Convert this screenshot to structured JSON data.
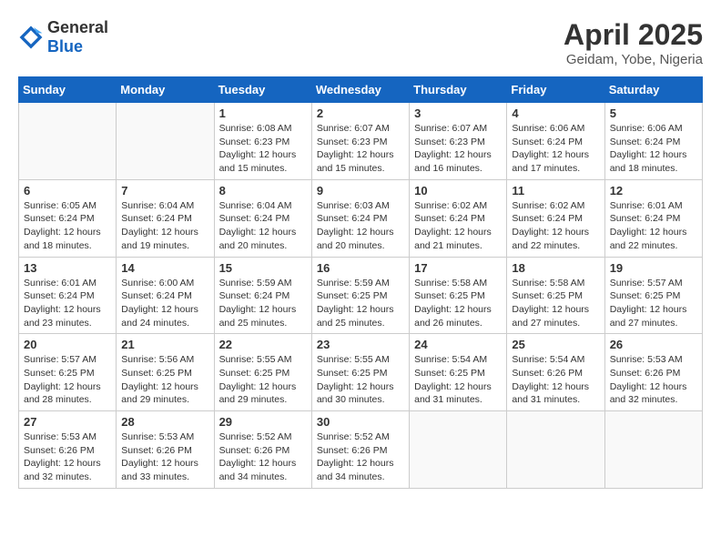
{
  "header": {
    "logo_general": "General",
    "logo_blue": "Blue",
    "month_title": "April 2025",
    "location": "Geidam, Yobe, Nigeria"
  },
  "days_of_week": [
    "Sunday",
    "Monday",
    "Tuesday",
    "Wednesday",
    "Thursday",
    "Friday",
    "Saturday"
  ],
  "weeks": [
    [
      {
        "day": "",
        "info": ""
      },
      {
        "day": "",
        "info": ""
      },
      {
        "day": "1",
        "info": "Sunrise: 6:08 AM\nSunset: 6:23 PM\nDaylight: 12 hours and 15 minutes."
      },
      {
        "day": "2",
        "info": "Sunrise: 6:07 AM\nSunset: 6:23 PM\nDaylight: 12 hours and 15 minutes."
      },
      {
        "day": "3",
        "info": "Sunrise: 6:07 AM\nSunset: 6:23 PM\nDaylight: 12 hours and 16 minutes."
      },
      {
        "day": "4",
        "info": "Sunrise: 6:06 AM\nSunset: 6:24 PM\nDaylight: 12 hours and 17 minutes."
      },
      {
        "day": "5",
        "info": "Sunrise: 6:06 AM\nSunset: 6:24 PM\nDaylight: 12 hours and 18 minutes."
      }
    ],
    [
      {
        "day": "6",
        "info": "Sunrise: 6:05 AM\nSunset: 6:24 PM\nDaylight: 12 hours and 18 minutes."
      },
      {
        "day": "7",
        "info": "Sunrise: 6:04 AM\nSunset: 6:24 PM\nDaylight: 12 hours and 19 minutes."
      },
      {
        "day": "8",
        "info": "Sunrise: 6:04 AM\nSunset: 6:24 PM\nDaylight: 12 hours and 20 minutes."
      },
      {
        "day": "9",
        "info": "Sunrise: 6:03 AM\nSunset: 6:24 PM\nDaylight: 12 hours and 20 minutes."
      },
      {
        "day": "10",
        "info": "Sunrise: 6:02 AM\nSunset: 6:24 PM\nDaylight: 12 hours and 21 minutes."
      },
      {
        "day": "11",
        "info": "Sunrise: 6:02 AM\nSunset: 6:24 PM\nDaylight: 12 hours and 22 minutes."
      },
      {
        "day": "12",
        "info": "Sunrise: 6:01 AM\nSunset: 6:24 PM\nDaylight: 12 hours and 22 minutes."
      }
    ],
    [
      {
        "day": "13",
        "info": "Sunrise: 6:01 AM\nSunset: 6:24 PM\nDaylight: 12 hours and 23 minutes."
      },
      {
        "day": "14",
        "info": "Sunrise: 6:00 AM\nSunset: 6:24 PM\nDaylight: 12 hours and 24 minutes."
      },
      {
        "day": "15",
        "info": "Sunrise: 5:59 AM\nSunset: 6:24 PM\nDaylight: 12 hours and 25 minutes."
      },
      {
        "day": "16",
        "info": "Sunrise: 5:59 AM\nSunset: 6:25 PM\nDaylight: 12 hours and 25 minutes."
      },
      {
        "day": "17",
        "info": "Sunrise: 5:58 AM\nSunset: 6:25 PM\nDaylight: 12 hours and 26 minutes."
      },
      {
        "day": "18",
        "info": "Sunrise: 5:58 AM\nSunset: 6:25 PM\nDaylight: 12 hours and 27 minutes."
      },
      {
        "day": "19",
        "info": "Sunrise: 5:57 AM\nSunset: 6:25 PM\nDaylight: 12 hours and 27 minutes."
      }
    ],
    [
      {
        "day": "20",
        "info": "Sunrise: 5:57 AM\nSunset: 6:25 PM\nDaylight: 12 hours and 28 minutes."
      },
      {
        "day": "21",
        "info": "Sunrise: 5:56 AM\nSunset: 6:25 PM\nDaylight: 12 hours and 29 minutes."
      },
      {
        "day": "22",
        "info": "Sunrise: 5:55 AM\nSunset: 6:25 PM\nDaylight: 12 hours and 29 minutes."
      },
      {
        "day": "23",
        "info": "Sunrise: 5:55 AM\nSunset: 6:25 PM\nDaylight: 12 hours and 30 minutes."
      },
      {
        "day": "24",
        "info": "Sunrise: 5:54 AM\nSunset: 6:25 PM\nDaylight: 12 hours and 31 minutes."
      },
      {
        "day": "25",
        "info": "Sunrise: 5:54 AM\nSunset: 6:26 PM\nDaylight: 12 hours and 31 minutes."
      },
      {
        "day": "26",
        "info": "Sunrise: 5:53 AM\nSunset: 6:26 PM\nDaylight: 12 hours and 32 minutes."
      }
    ],
    [
      {
        "day": "27",
        "info": "Sunrise: 5:53 AM\nSunset: 6:26 PM\nDaylight: 12 hours and 32 minutes."
      },
      {
        "day": "28",
        "info": "Sunrise: 5:53 AM\nSunset: 6:26 PM\nDaylight: 12 hours and 33 minutes."
      },
      {
        "day": "29",
        "info": "Sunrise: 5:52 AM\nSunset: 6:26 PM\nDaylight: 12 hours and 34 minutes."
      },
      {
        "day": "30",
        "info": "Sunrise: 5:52 AM\nSunset: 6:26 PM\nDaylight: 12 hours and 34 minutes."
      },
      {
        "day": "",
        "info": ""
      },
      {
        "day": "",
        "info": ""
      },
      {
        "day": "",
        "info": ""
      }
    ]
  ]
}
